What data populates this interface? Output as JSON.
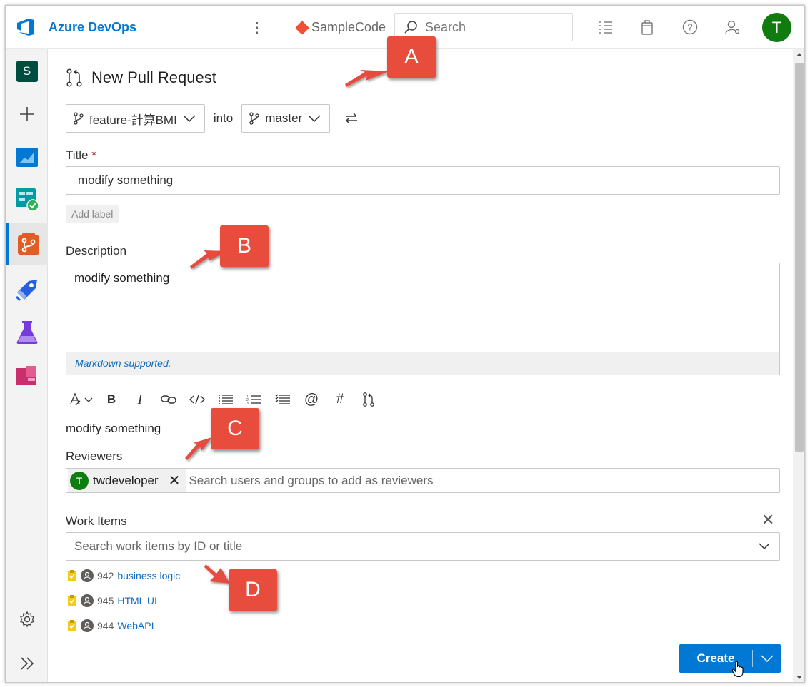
{
  "header": {
    "brand": "Azure DevOps",
    "project": "SampleCode",
    "search_placeholder": "Search",
    "user_initial": "T"
  },
  "leftnav": {
    "project_initial": "S",
    "items": [
      "new",
      "overview",
      "boards",
      "repos",
      "pipelines",
      "test-plans",
      "artifacts"
    ]
  },
  "page": {
    "title": "New Pull Request",
    "source_branch": "feature-計算BMI",
    "into": "into",
    "target_branch": "master"
  },
  "form": {
    "title_label": "Title",
    "title_required": "*",
    "title_value": "modify something",
    "add_label": "Add label",
    "description_label": "Description",
    "description_value": "modify something",
    "markdown_hint": "Markdown supported.",
    "preview_text": "modify something",
    "reviewers_label": "Reviewers",
    "reviewer": {
      "initial": "T",
      "name": "twdeveloper"
    },
    "reviewers_placeholder": "Search users and groups to add as reviewers",
    "work_items_label": "Work Items",
    "work_items_placeholder": "Search work items by ID or title",
    "work_items": [
      {
        "id": "942",
        "title": "business logic"
      },
      {
        "id": "945",
        "title": "HTML UI"
      },
      {
        "id": "944",
        "title": "WebAPI"
      }
    ],
    "create_label": "Create"
  },
  "callouts": {
    "a": "A",
    "b": "B",
    "c": "C",
    "d": "D"
  },
  "colors": {
    "accent": "#0078d4",
    "callout": "#e74c3c",
    "avatar": "#107c10"
  }
}
